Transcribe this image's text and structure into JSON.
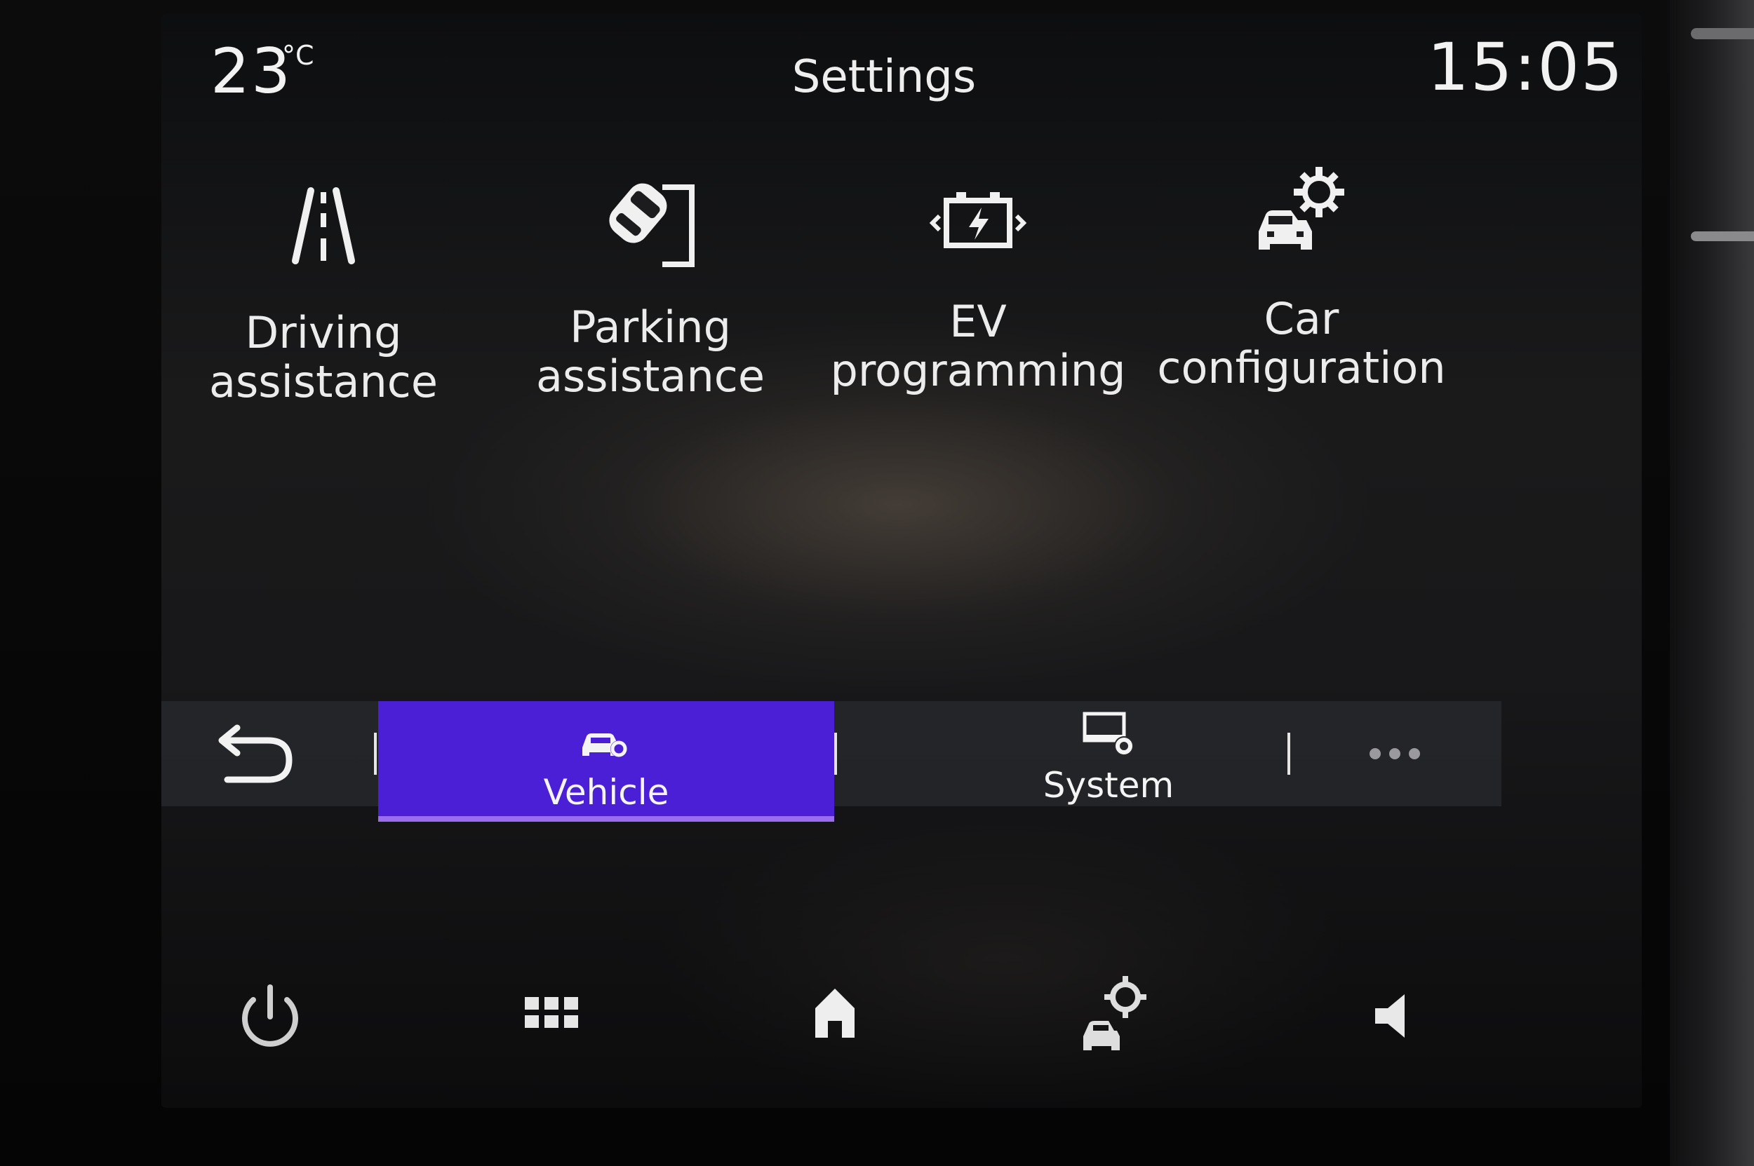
{
  "header": {
    "temperature": "23",
    "temperature_unit": "°C",
    "title": "Settings",
    "time": "15:05"
  },
  "tiles": [
    {
      "id": "driving",
      "label": "Driving\nassistance",
      "icon": "road-lanes-icon"
    },
    {
      "id": "parking",
      "label": "Parking\nassistance",
      "icon": "parking-car-icon"
    },
    {
      "id": "ev",
      "label": "EV\nprogramming",
      "icon": "battery-charge-icon"
    },
    {
      "id": "car",
      "label": "Car\nconfiguration",
      "icon": "car-gear-icon"
    }
  ],
  "tabbar": {
    "back_icon": "back-arrow-icon",
    "tabs": [
      {
        "label": "Vehicle",
        "icon": "car-gear-icon",
        "active": true
      },
      {
        "label": "System",
        "icon": "monitor-gear-icon",
        "active": false
      }
    ],
    "more_icon": "more-dots-icon"
  },
  "dock": [
    {
      "icon": "power-icon"
    },
    {
      "icon": "apps-grid-icon"
    },
    {
      "icon": "home-icon"
    },
    {
      "icon": "car-gear-icon"
    },
    {
      "icon": "speaker-icon"
    }
  ],
  "colors": {
    "active_tab": "#4b1fd6",
    "active_tab_underline": "#9a6cf0",
    "text": "#ececec"
  }
}
